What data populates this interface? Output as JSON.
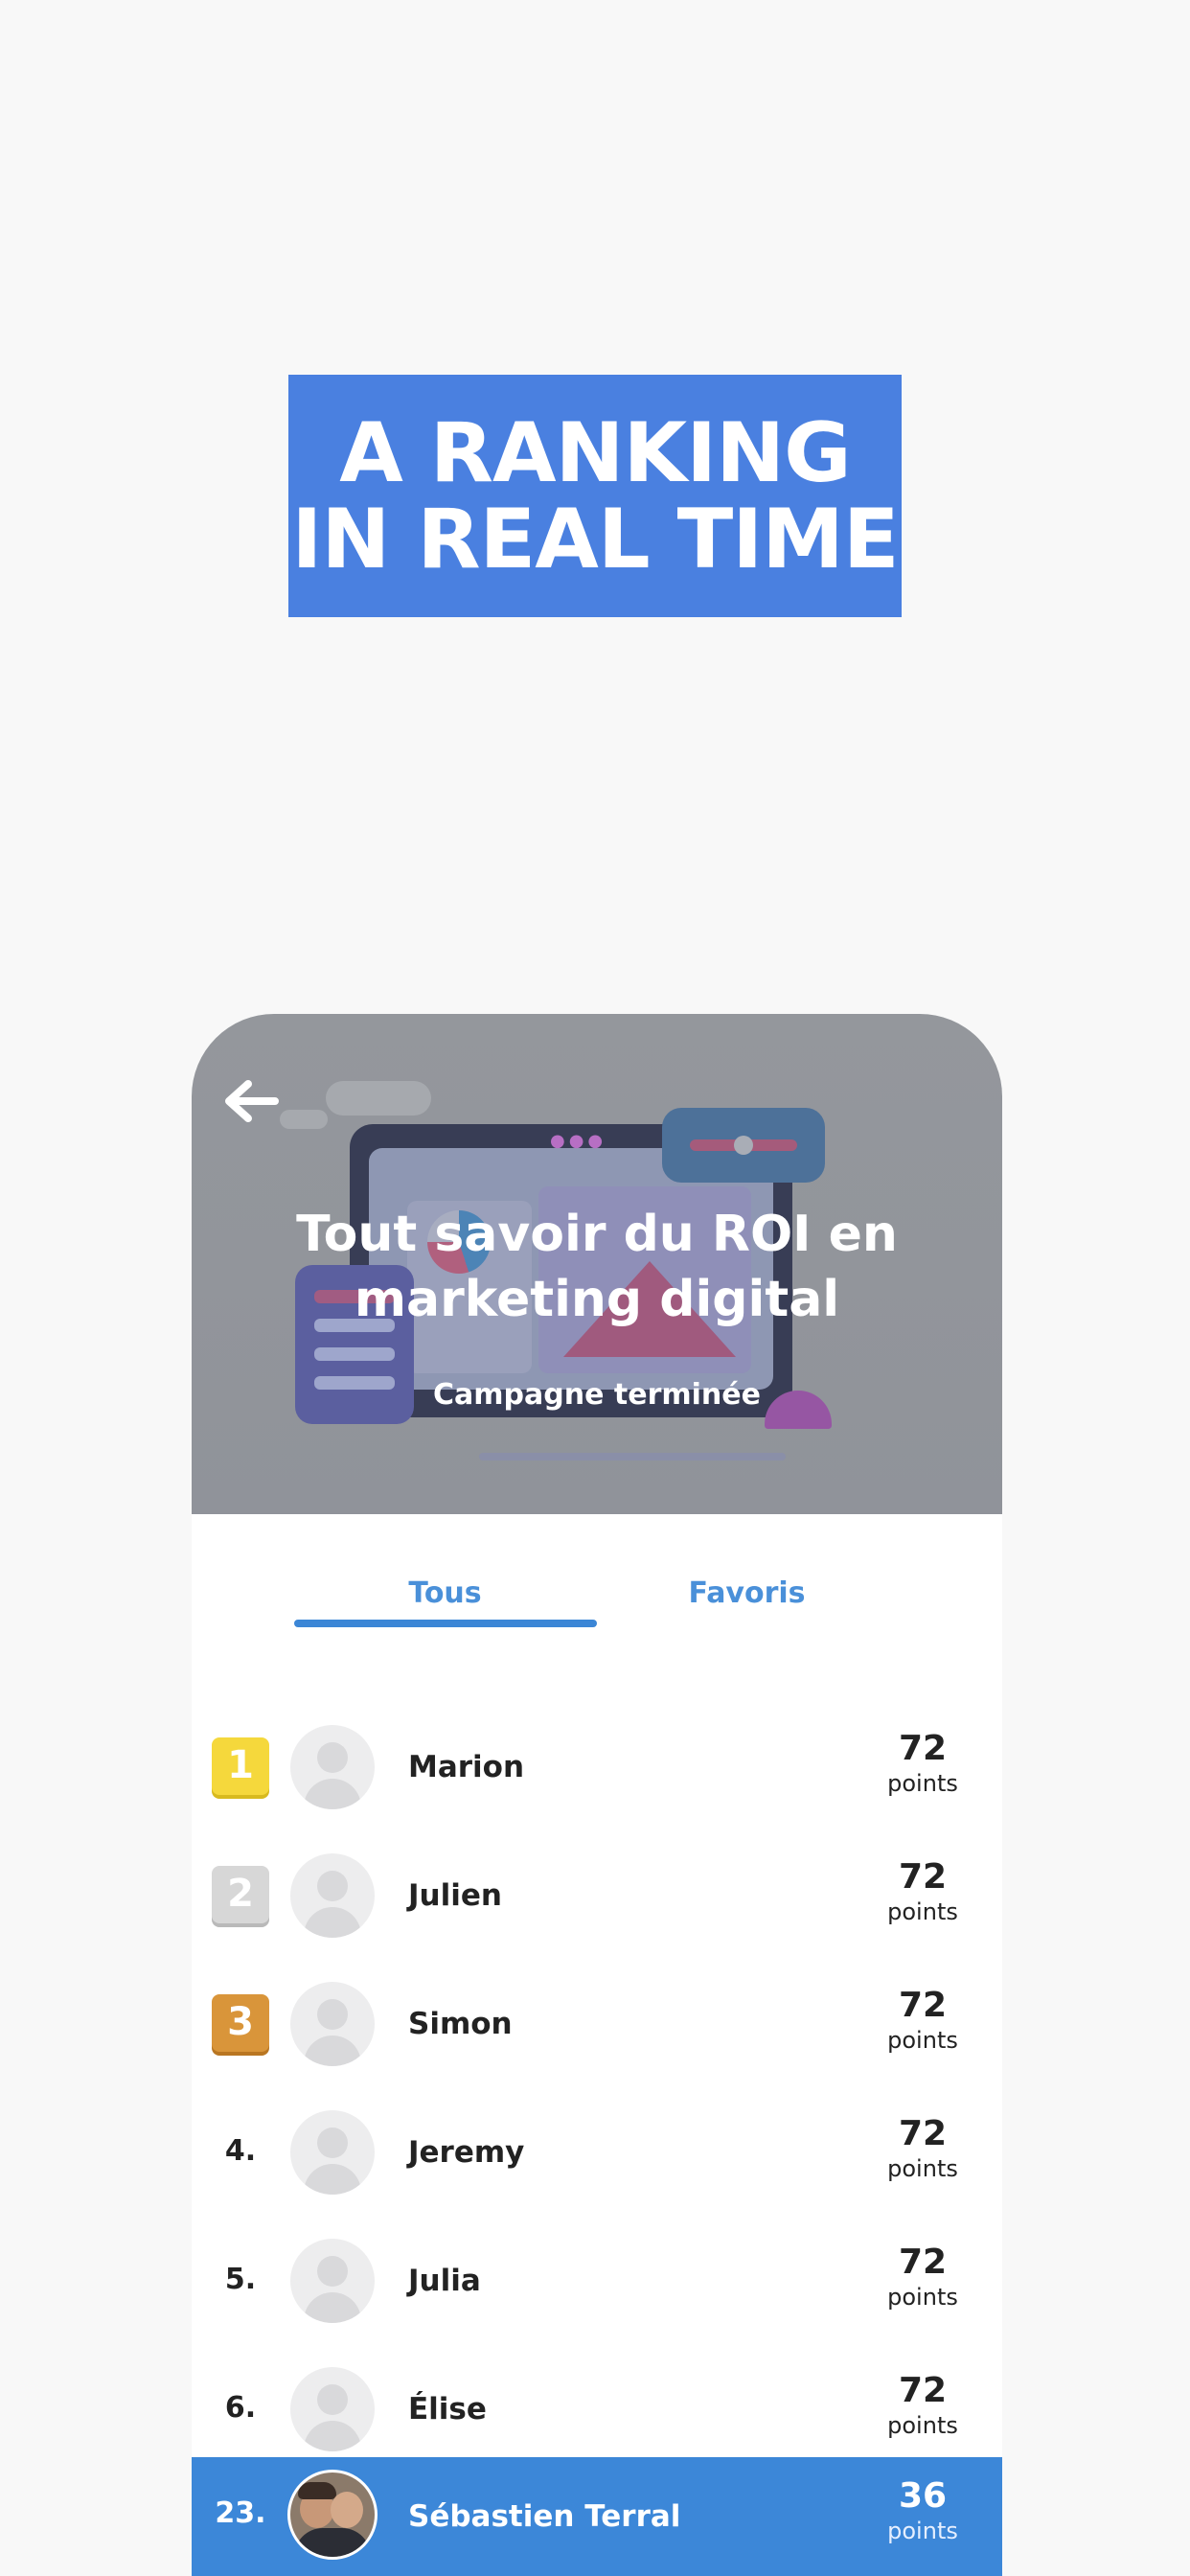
{
  "headline": {
    "line1": "A RANKING",
    "line2": "IN REAL TIME"
  },
  "hero": {
    "title": "Tout savoir du ROI en marketing digital",
    "status": "Campagne terminée"
  },
  "tabs": [
    {
      "label": "Tous",
      "active": true
    },
    {
      "label": "Favoris",
      "active": false
    }
  ],
  "leaderboard": [
    {
      "rank": "1",
      "name": "Marion",
      "score": "72",
      "unit": "points",
      "badge_color": "#f5d83c"
    },
    {
      "rank": "2",
      "name": "Julien",
      "score": "72",
      "unit": "points",
      "badge_color": "#d7d7d7"
    },
    {
      "rank": "3",
      "name": "Simon",
      "score": "72",
      "unit": "points",
      "badge_color": "#d9953a"
    },
    {
      "rank": "4.",
      "name": "Jeremy",
      "score": "72",
      "unit": "points"
    },
    {
      "rank": "5.",
      "name": "Julia",
      "score": "72",
      "unit": "points"
    },
    {
      "rank": "6.",
      "name": "Élise",
      "score": "72",
      "unit": "points"
    }
  ],
  "current_user": {
    "rank": "23.",
    "name": "Sébastien Terral",
    "score": "36",
    "unit": "points"
  },
  "colors": {
    "accent": "#3c87d8",
    "headline_bg": "#4a80e0",
    "page_bg": "#f8f8f8"
  }
}
